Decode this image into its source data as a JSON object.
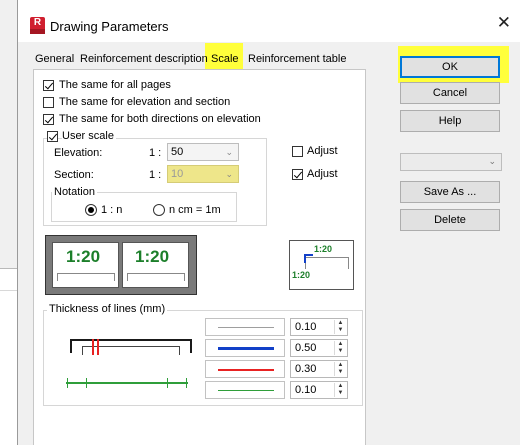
{
  "window": {
    "title": "Drawing Parameters",
    "app_icon_letter": "R",
    "close_glyph": "✕"
  },
  "tabs": [
    {
      "label": "General",
      "active": false
    },
    {
      "label": "Reinforcement description",
      "active": false
    },
    {
      "label": "Scale",
      "active": true
    },
    {
      "label": "Reinforcement table",
      "active": false
    }
  ],
  "options": {
    "same_all_pages": {
      "label": "The same for all pages",
      "checked": true
    },
    "same_elevation_section": {
      "label": "The same for elevation and section",
      "checked": false
    },
    "same_both_directions": {
      "label": "The same for both directions on elevation",
      "checked": true
    },
    "user_scale": {
      "label": "User scale",
      "checked": true
    }
  },
  "scale": {
    "elevation": {
      "label": "Elevation:",
      "prefix": "1 :",
      "value": "50",
      "adjust_label": "Adjust",
      "adjust_checked": false
    },
    "section": {
      "label": "Section:",
      "prefix": "1 :",
      "value": "10",
      "adjust_label": "Adjust",
      "adjust_checked": true
    }
  },
  "notation": {
    "title": "Notation",
    "options": [
      {
        "label": "1 : n",
        "selected": true
      },
      {
        "label": "n cm = 1m",
        "selected": false
      }
    ]
  },
  "preview": {
    "scale_left": "1:20",
    "scale_right": "1:20",
    "small_top": "1:20",
    "small_bottom": "1:20"
  },
  "thickness": {
    "title": "Thickness of lines (mm)",
    "rows": [
      {
        "value": "0.10",
        "color": "#9e9e9e",
        "weight": 1
      },
      {
        "value": "0.50",
        "color": "#1240c8",
        "weight": 3
      },
      {
        "value": "0.30",
        "color": "#e82222",
        "weight": 2
      },
      {
        "value": "0.10",
        "color": "#2f9e3a",
        "weight": 1
      }
    ]
  },
  "buttons": {
    "ok": "OK",
    "cancel": "Cancel",
    "help": "Help",
    "save_as": "Save As ...",
    "delete": "Delete"
  },
  "side_combo": {
    "value": ""
  },
  "colors": {
    "highlight": "#ffff3b",
    "scale_green": "#1c7f2a",
    "focus_blue": "#0078d7"
  }
}
